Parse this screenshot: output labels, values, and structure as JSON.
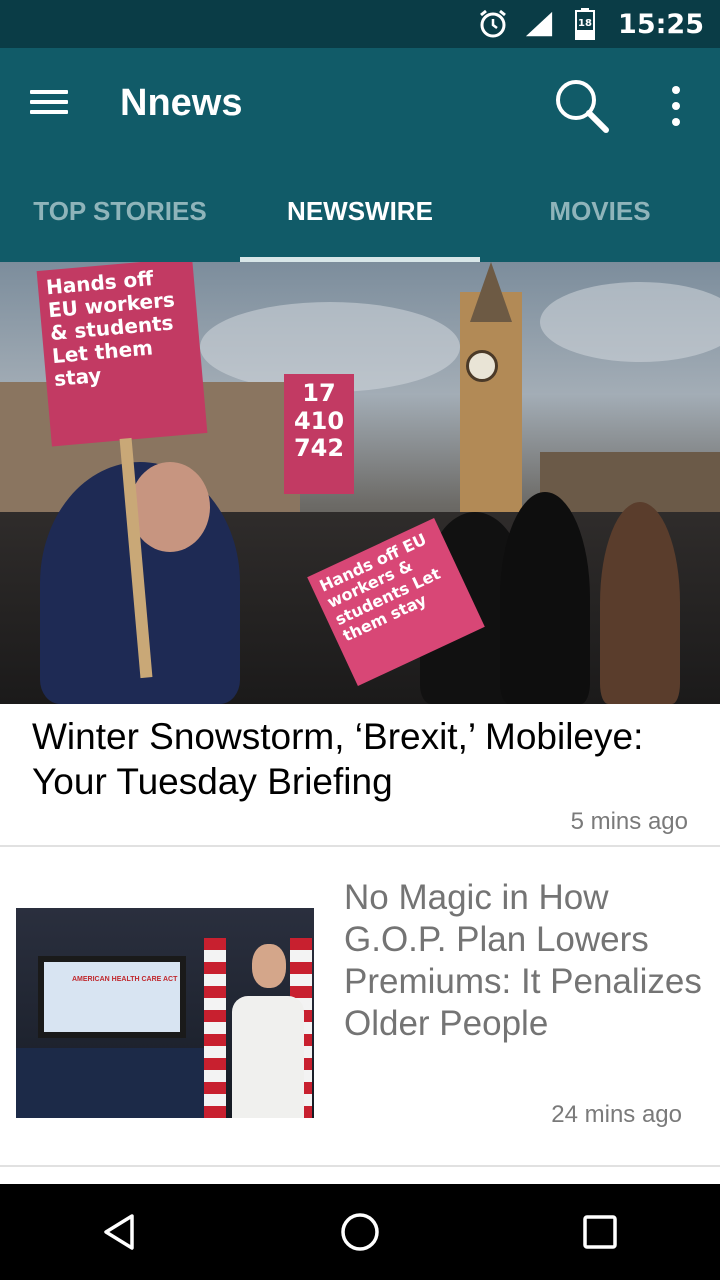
{
  "status_bar": {
    "time": "15:25",
    "battery_level": "18",
    "icons": [
      "alarm-icon",
      "signal-icon",
      "battery-icon"
    ]
  },
  "app_bar": {
    "title": "Nnews",
    "icons": [
      "menu-icon",
      "search-icon",
      "more-vert-icon"
    ],
    "background_color": "#115b68"
  },
  "tabs": [
    {
      "label": "TOP STORIES",
      "active": false
    },
    {
      "label": "NEWSWIRE",
      "active": true
    },
    {
      "label": "MOVIES",
      "active": false
    }
  ],
  "hero_image": {
    "sign_text_1": "Hands off EU workers & students Let them stay",
    "sign_text_2": "17 410 742",
    "sign_text_3": "Hands off EU workers & students Let them stay"
  },
  "articles": [
    {
      "title": "Winter Snowstorm, ‘Brexit,’ Mobileye: Your Tuesday Briefing",
      "time": "5 mins ago"
    },
    {
      "title": "No Magic in How G.O.P. Plan Lowers Premiums: It Penalizes Older People",
      "time": "24 mins ago",
      "thumbnail_text": "AMERICAN HEALTH CARE ACT"
    }
  ],
  "nav_bar": {
    "icons": [
      "back-icon",
      "home-icon",
      "recents-icon"
    ]
  }
}
